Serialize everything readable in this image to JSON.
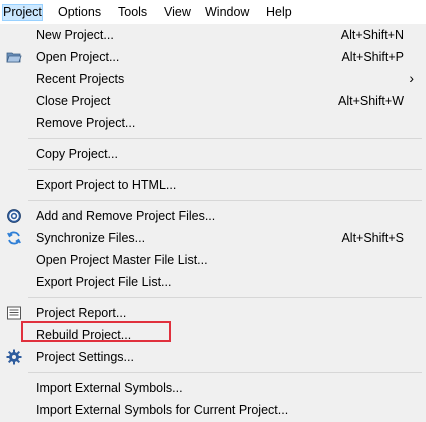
{
  "menubar": {
    "items": [
      "Project",
      "Options",
      "Tools",
      "View",
      "Window",
      "Help"
    ]
  },
  "menu": {
    "items": [
      {
        "label": "New Project...",
        "shortcut": "Alt+Shift+N"
      },
      {
        "label": "Open Project...",
        "shortcut": "Alt+Shift+P",
        "icon": "open-folder-icon"
      },
      {
        "label": "Recent Projects",
        "submenu": "›"
      },
      {
        "label": "Close Project",
        "shortcut": "Alt+Shift+W"
      },
      {
        "label": "Remove Project..."
      },
      {
        "label": "Copy Project..."
      },
      {
        "label": "Export Project to HTML..."
      },
      {
        "label": "Add and Remove Project Files...",
        "icon": "add-remove-files-icon"
      },
      {
        "label": "Synchronize Files...",
        "shortcut": "Alt+Shift+S",
        "icon": "sync-icon"
      },
      {
        "label": "Open Project Master File List..."
      },
      {
        "label": "Export Project File List..."
      },
      {
        "label": "Project Report...",
        "icon": "report-icon"
      },
      {
        "label": "Rebuild Project..."
      },
      {
        "label": "Project Settings...",
        "icon": "gear-icon"
      },
      {
        "label": "Import External Symbols..."
      },
      {
        "label": "Import External Symbols for Current Project..."
      }
    ]
  },
  "colors": {
    "highlight_border": "#e0303d",
    "menu_background": "#f0f0f0",
    "active_menu": "#cce8ff"
  }
}
